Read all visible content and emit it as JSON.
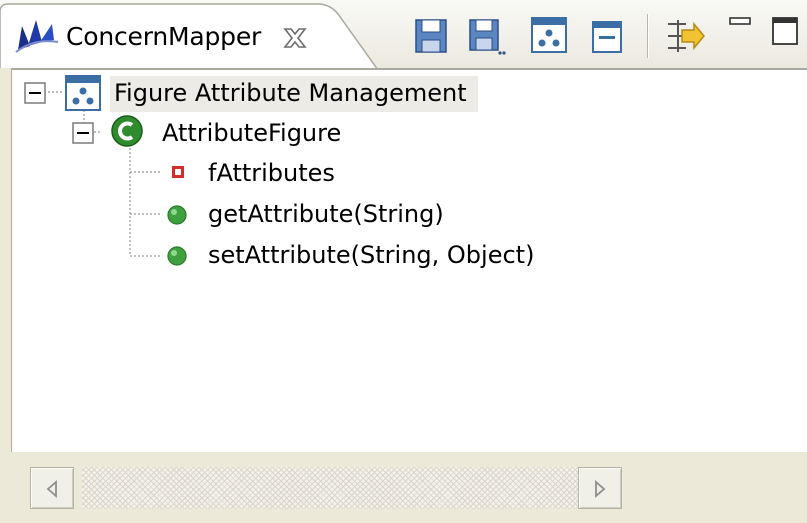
{
  "view": {
    "title": "ConcernMapper",
    "tab_icon": "concernmapper-logo-icon",
    "close_icon": "close-tab-icon"
  },
  "toolbar": [
    {
      "name": "save-icon"
    },
    {
      "name": "save-as-icon"
    },
    {
      "name": "new-concern-icon"
    },
    {
      "name": "collapse-all-icon"
    },
    {
      "name": "filter-icon"
    },
    {
      "name": "minimize-icon"
    },
    {
      "name": "maximize-icon"
    }
  ],
  "tree": {
    "root": {
      "label": "Figure Attribute Management",
      "icon": "concern-icon",
      "expanded": true
    },
    "class": {
      "label": "AttributeFigure",
      "icon": "class-icon",
      "expanded": true
    },
    "members": [
      {
        "label": "fAttributes",
        "icon": "private-field-icon"
      },
      {
        "label": "getAttribute(String)",
        "icon": "public-method-icon"
      },
      {
        "label": "setAttribute(String, Object)",
        "icon": "public-method-icon"
      }
    ]
  },
  "colors": {
    "method_green": "#3fa03f",
    "field_red": "#d42b2b",
    "class_green": "#2e8b2e",
    "toolbar_blue": "#3a6ea5"
  },
  "scrollbar": {
    "left_icon": "scroll-left-arrow-icon",
    "right_icon": "scroll-right-arrow-icon"
  }
}
